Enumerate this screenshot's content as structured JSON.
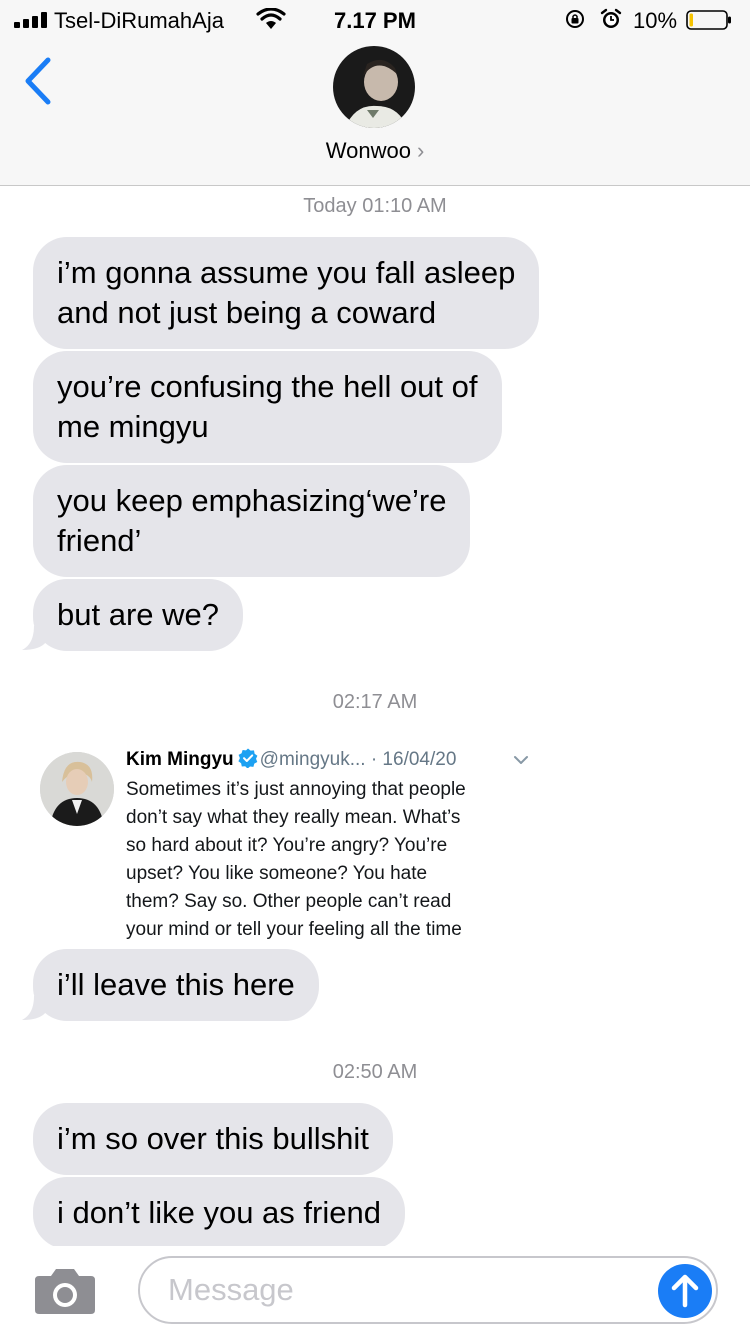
{
  "status_bar": {
    "carrier": "Tsel-DiRumahAja",
    "time": "7.17 PM",
    "battery_percent": "10%",
    "battery_level": 0.1,
    "icons": [
      "signal-icon",
      "wifi-icon",
      "rotation-lock-icon",
      "alarm-icon",
      "battery-icon"
    ]
  },
  "header": {
    "contact_name": "Wonwoo",
    "chevron": "›",
    "back_icon": "chevron-left-icon"
  },
  "thread": {
    "timestamps": [
      "Today 01:10 AM",
      "02:17 AM",
      "02:50 AM"
    ],
    "messages": [
      "i’m gonna assume you fall asleep and not just being a coward",
      "you’re confusing the hell out of me mingyu",
      "you keep emphasizing‘we’re friend’",
      "but are we?",
      "i’ll leave this here",
      "i’m so over this bullshit",
      "i don’t like you as friend"
    ],
    "message_lines": [
      [
        "i’m gonna assume you fall asleep",
        "and not just being a coward"
      ],
      [
        "you’re confusing the hell out of",
        "me mingyu"
      ],
      [
        "you keep emphasizing‘we’re",
        "friend’"
      ],
      [
        "but are we?"
      ],
      [
        "i’ll leave this here"
      ],
      [
        "i’m so over this bullshit"
      ],
      [
        "i don’t like you as friend"
      ]
    ]
  },
  "tweet": {
    "name": "Kim Mingyu",
    "handle": "@mingyuk...",
    "date": "· 16/04/20",
    "lines": [
      "Sometimes it’s just annoying that people",
      "don’t say what they really mean. What’s",
      "so hard about it? You’re angry? You’re",
      "upset? You like someone? You hate",
      "them? Say so. Other people can’t read",
      "your mind or tell your feeling all the time"
    ]
  },
  "input": {
    "placeholder": "Message",
    "value": ""
  },
  "colors": {
    "bubble": "#e5e5ea",
    "accent": "#1a7df6",
    "timestamp": "#8e8e93",
    "verified": "#1da1f2"
  }
}
